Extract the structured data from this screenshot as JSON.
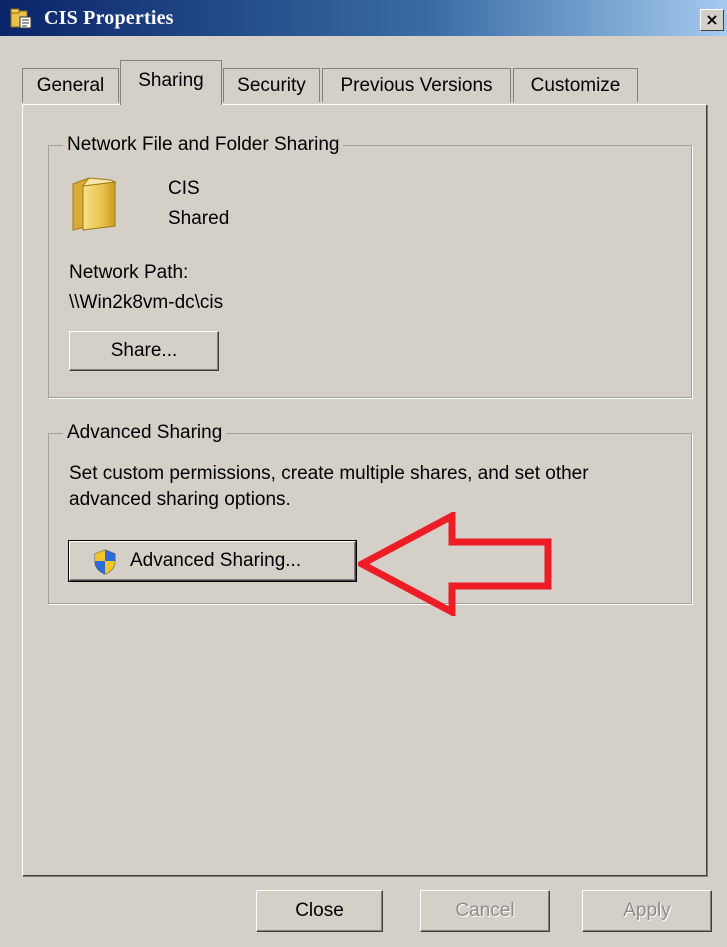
{
  "window": {
    "title": "CIS Properties",
    "close_glyph": "×",
    "icon": "folder-properties-icon"
  },
  "tabs": [
    {
      "label": "General"
    },
    {
      "label": "Sharing",
      "active": true
    },
    {
      "label": "Security"
    },
    {
      "label": "Previous Versions"
    },
    {
      "label": "Customize"
    }
  ],
  "network_sharing": {
    "legend": "Network File and Folder Sharing",
    "folder_name": "CIS",
    "folder_status": "Shared",
    "path_label": "Network Path:",
    "path_value": "\\\\Win2k8vm-dc\\cis",
    "share_button": "Share..."
  },
  "advanced_sharing": {
    "legend": "Advanced Sharing",
    "description_line1": "Set custom permissions, create multiple shares, and set other",
    "description_line2": "advanced sharing options.",
    "button_label": "Advanced Sharing...",
    "button_icon": "uac-shield-icon"
  },
  "footer": {
    "close": "Close",
    "cancel": "Cancel",
    "apply": "Apply"
  },
  "colors": {
    "window_bg": "#d4d0c8",
    "annotation_arrow": "#ee1c24"
  }
}
